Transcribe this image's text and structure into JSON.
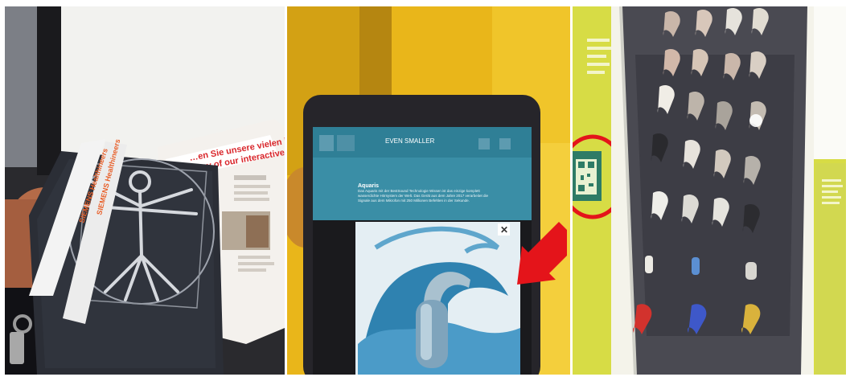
{
  "panels": [
    {
      "name": "tablet-with-lanyard",
      "lanyard_text": "SIEMENS Healthineers",
      "brochure_headline": [
        "…en Sie unsere vielen inte…",
        "…any of our interactive…"
      ]
    },
    {
      "name": "tablet-app-screen",
      "app_title": "EVEN SMALLER",
      "article_heading": "Aquaris",
      "article_body": "Das Aquaris mit der BestSound Technologie Wissen ist das einzige komplett wasserdichte Hörsystem der Welt. Das Gerät aus dem Jahre 2017 verarbeitet die Signale aus dem Mikrofon mit 250 Millionen Befehlen in der Sekunde.",
      "close_glyph": "✕"
    },
    {
      "name": "hearing-aid-display-case",
      "callout": "qr-code-highlight"
    }
  ],
  "colors": {
    "app_bar": "#2f7f96",
    "app_panel": "#3a8ea6",
    "highlight_red": "#e4141a",
    "wall_yellow_green": "#d9dd48",
    "lanyard_red": "#e8602a"
  }
}
